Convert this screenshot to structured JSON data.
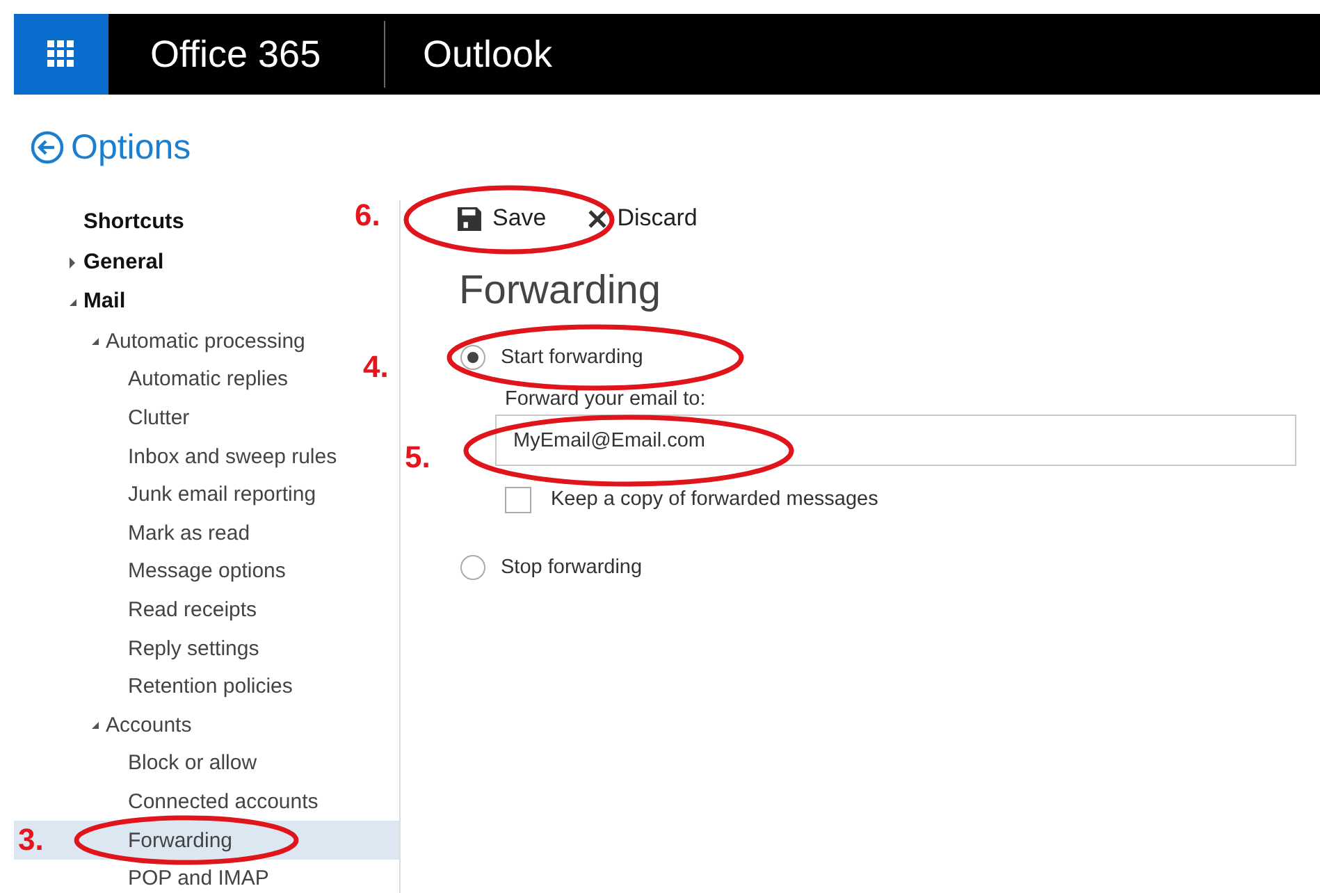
{
  "app_bar": {
    "brand": "Office 365",
    "app": "Outlook"
  },
  "page_title": "Options",
  "sidebar": {
    "items": [
      {
        "label": "Shortcuts",
        "selected": false
      },
      {
        "label": "General",
        "expanded": false,
        "selected": false
      },
      {
        "label": "Mail",
        "expanded": true,
        "selected": false,
        "children": [
          {
            "label": "Automatic processing",
            "expanded": true,
            "selected": false,
            "children": [
              {
                "label": "Automatic replies",
                "selected": false
              },
              {
                "label": "Clutter",
                "selected": false
              },
              {
                "label": "Inbox and sweep rules",
                "selected": false
              },
              {
                "label": "Junk email reporting",
                "selected": false
              },
              {
                "label": "Mark as read",
                "selected": false
              },
              {
                "label": "Message options",
                "selected": false
              },
              {
                "label": "Read receipts",
                "selected": false
              },
              {
                "label": "Reply settings",
                "selected": false
              },
              {
                "label": "Retention policies",
                "selected": false
              }
            ]
          },
          {
            "label": "Accounts",
            "expanded": true,
            "selected": false,
            "children": [
              {
                "label": "Block or allow",
                "selected": false
              },
              {
                "label": "Connected accounts",
                "selected": false
              },
              {
                "label": "Forwarding",
                "selected": true
              },
              {
                "label": "POP and IMAP",
                "selected": false
              }
            ]
          }
        ]
      }
    ]
  },
  "toolbar": {
    "buttons": [
      {
        "kind": "save",
        "label": "Save"
      },
      {
        "kind": "discard",
        "label": "Discard"
      }
    ]
  },
  "forwarding": {
    "title": "Forwarding",
    "options": [
      {
        "label": "Start forwarding",
        "selected": true
      },
      {
        "label": "Stop forwarding",
        "selected": false
      }
    ],
    "address_label": "Forward your email to:",
    "address": "MyEmail@Email.com",
    "keep_copy": {
      "label": "Keep a copy of forwarded messages",
      "checked": false
    }
  },
  "annotations": [
    {
      "label": "6."
    },
    {
      "label": "4."
    },
    {
      "label": "5."
    },
    {
      "label": "3."
    }
  ]
}
